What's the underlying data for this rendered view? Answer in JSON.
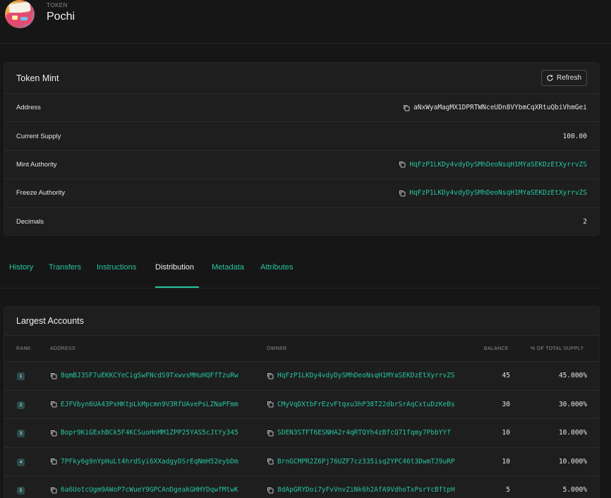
{
  "header": {
    "kicker": "TOKEN",
    "title": "Pochi"
  },
  "mint_card": {
    "title": "Token Mint",
    "refresh_label": "Refresh",
    "rows": [
      {
        "label": "Address",
        "value": "aNxWyaMagMX1DPRTWNceUDn8VYbmCqXRtuQbiVhmGei"
      },
      {
        "label": "Current Supply",
        "value": "100.00"
      },
      {
        "label": "Mint Authority",
        "value": "HqFzP1LKDy4vdyDySMhDeoNsqH1MYaSEKDzEtXyrrvZS"
      },
      {
        "label": "Freeze Authority",
        "value": "HqFzP1LKDy4vdyDySMhDeoNsqH1MYaSEKDzEtXyrrvZS"
      },
      {
        "label": "Decimals",
        "value": "2"
      }
    ]
  },
  "tabs": [
    "History",
    "Transfers",
    "Instructions",
    "Distribution",
    "Metadata",
    "Attributes"
  ],
  "active_tab": "Distribution",
  "largest_accounts": {
    "title": "Largest Accounts",
    "columns": [
      "RANK",
      "ADDRESS",
      "OWNER",
      "BALANCE",
      "% OF TOTAL SUPPLY"
    ],
    "rows": [
      {
        "rank": "1",
        "address": "8qmBJ3SF7uEKKCYeCigSwFNcdS9TxwvsMHuHQFfTzuRw",
        "owner": "HqFzP1LKDy4vdyDySMhDeoNsqH1MYaSEKDzEtXyrrvZS",
        "balance": "45",
        "pct": "45.000%"
      },
      {
        "rank": "2",
        "address": "EJFVbyn6UA43PxHKtpLkMpcmn9V3RfUAvePsLZNaPFmm",
        "owner": "CMyVqDXtbFrEzvFtqxu3hP38T22dbrSrAqCxtuDzKeBs",
        "balance": "30",
        "pct": "30.000%"
      },
      {
        "rank": "3",
        "address": "Bopr9KiGExhBCk5F4KCSuoHnMM1ZPP25YAS5cJtYy345",
        "owner": "SDEN3STFT6ESNHA2r4qRTQYh4zBfcQ71fqmy7PbbYYf",
        "balance": "10",
        "pct": "10.000%"
      },
      {
        "rank": "4",
        "address": "7PFky6g9nYpHuLt4hrdSyi6XXadgyDSrEqNmH52eybDm",
        "owner": "BrnGCMPR2Z6Pj76UZF7cz335isq2YPC46t3DwmTJ9uRP",
        "balance": "10",
        "pct": "10.000%"
      },
      {
        "rank": "5",
        "address": "6a6UotcUgm9AWoP7cWueY9GPCAnDgeakGHHYDqwfMtwK",
        "owner": "8dApGRYDoi7yFvVnvZiNk6h2AfA9VdhoTxPsrYcBftpH",
        "balance": "5",
        "pct": "5.000%"
      }
    ]
  },
  "colors": {
    "background": "#161616",
    "card": "#1e1e1e",
    "accent": "#26c6a0",
    "muted": "#8d8d8d"
  },
  "icons": {
    "copy": "copy-icon",
    "refresh": "refresh-icon"
  }
}
